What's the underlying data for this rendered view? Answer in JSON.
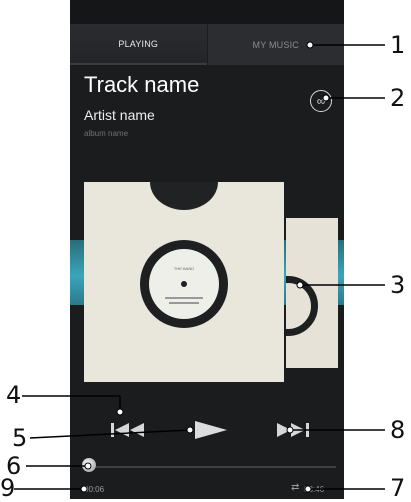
{
  "tabs": [
    {
      "label": "PLAYING"
    },
    {
      "label": "MY MUSIC"
    }
  ],
  "track": {
    "name": "Track name",
    "artist": "Artist name",
    "album": "album name"
  },
  "album_art": {
    "label_title": "THE BAND"
  },
  "controls": {
    "prev_icon": "skip-previous-icon",
    "play_icon": "play-icon",
    "next_icon": "skip-next-icon",
    "infinite_icon": "infinite-icon",
    "repeat_icon": "repeat-icon",
    "infinite_glyph": "∞",
    "repeat_glyph": "⇄"
  },
  "progress": {
    "elapsed": "00:06",
    "duration": "03:46",
    "fraction": 0.03
  },
  "callouts": [
    "1",
    "2",
    "3",
    "4",
    "5",
    "6",
    "7",
    "8",
    "9"
  ],
  "colors": {
    "background": "#1a1c1e",
    "accent_band": "#3aa5b9"
  }
}
